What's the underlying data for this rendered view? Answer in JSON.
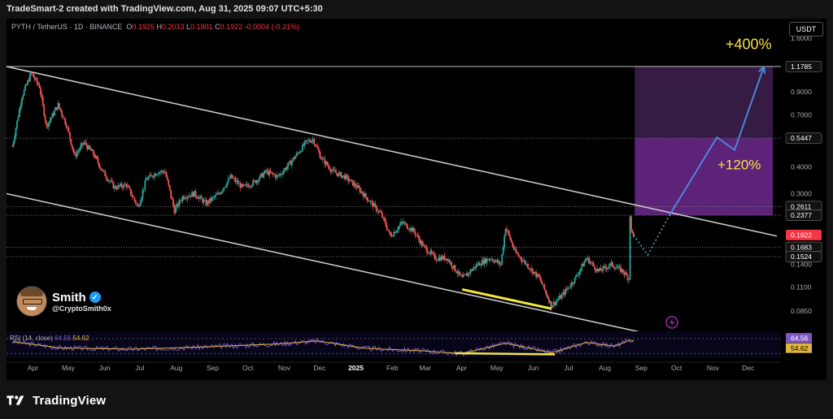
{
  "header": {
    "title": "TradeSmart-2 created with TradingView.com, Aug 31, 2025 09:07 UTC+5:30"
  },
  "symbol": {
    "name": "PYTH / TetherUS · 1D · BINANCE",
    "open_label": "O",
    "open": "0.1925",
    "high_label": "H",
    "high": "0.2013",
    "low_label": "L",
    "low": "0.1901",
    "close_label": "C",
    "close": "0.1922",
    "change": "-0.0004 (-0.21%)"
  },
  "currency": "USDT",
  "author": {
    "name": "Smith",
    "handle": "@CryptoSmith0x"
  },
  "footer": {
    "brand": "TradingView"
  },
  "rsi": {
    "label": "RSI (14, close)",
    "value_a": "64.56",
    "value_b": "54.62"
  },
  "colors": {
    "up": "#26a69a",
    "down": "#ef5350",
    "channel": "#c8c8c8",
    "projection": "#4a90e2",
    "zone_low": "#7b2fa0",
    "zone_high": "#3c1f4d",
    "highlight": "#f5e642",
    "rsi_line": "#7e57c2",
    "rsi_ma": "#e0b43a"
  },
  "annotations": {
    "target_high": "+400%",
    "target_mid": "+120%"
  },
  "chart_data": {
    "type": "candlestick",
    "title": "PYTH / TetherUS · 1D · BINANCE",
    "y_scale": "log",
    "ylim": [
      0.07,
      1.7
    ],
    "xlabel": "",
    "ylabel": "",
    "x_ticks": [
      "Apr",
      "May",
      "Jun",
      "Jul",
      "Aug",
      "Sep",
      "Oct",
      "Nov",
      "Dec",
      "2025",
      "Feb",
      "Mar",
      "Apr",
      "May",
      "Jun",
      "Jul",
      "Aug",
      "Sep",
      "Oct",
      "Nov",
      "Dec"
    ],
    "y_ticks": [
      "1.6000",
      "0.9000",
      "0.7000",
      "0.4000",
      "0.3000",
      "0.1400",
      "0.1100",
      "0.0850"
    ],
    "price_labels": [
      {
        "value": "1.1785",
        "kind": "level"
      },
      {
        "value": "0.5447",
        "kind": "level"
      },
      {
        "value": "0.2611",
        "kind": "level"
      },
      {
        "value": "0.2377",
        "kind": "level"
      },
      {
        "value": "0.1922",
        "kind": "last"
      },
      {
        "value": "0.1683",
        "kind": "level"
      },
      {
        "value": "0.1524",
        "kind": "level"
      }
    ],
    "price_path": [
      [
        "2024-03-20",
        0.5
      ],
      [
        "2024-03-28",
        0.85
      ],
      [
        "2024-04-05",
        1.1
      ],
      [
        "2024-04-12",
        0.95
      ],
      [
        "2024-04-18",
        0.62
      ],
      [
        "2024-04-28",
        0.78
      ],
      [
        "2024-05-05",
        0.63
      ],
      [
        "2024-05-12",
        0.45
      ],
      [
        "2024-05-20",
        0.52
      ],
      [
        "2024-05-28",
        0.46
      ],
      [
        "2024-06-05",
        0.38
      ],
      [
        "2024-06-15",
        0.32
      ],
      [
        "2024-06-25",
        0.33
      ],
      [
        "2024-07-05",
        0.26
      ],
      [
        "2024-07-12",
        0.35
      ],
      [
        "2024-07-22",
        0.38
      ],
      [
        "2024-07-28",
        0.38
      ],
      [
        "2024-08-05",
        0.25
      ],
      [
        "2024-08-12",
        0.29
      ],
      [
        "2024-08-22",
        0.3
      ],
      [
        "2024-09-01",
        0.27
      ],
      [
        "2024-09-12",
        0.3
      ],
      [
        "2024-09-22",
        0.36
      ],
      [
        "2024-10-02",
        0.32
      ],
      [
        "2024-10-12",
        0.34
      ],
      [
        "2024-10-22",
        0.38
      ],
      [
        "2024-11-01",
        0.36
      ],
      [
        "2024-11-12",
        0.42
      ],
      [
        "2024-11-25",
        0.52
      ],
      [
        "2024-12-01",
        0.54
      ],
      [
        "2024-12-08",
        0.44
      ],
      [
        "2024-12-18",
        0.38
      ],
      [
        "2024-12-28",
        0.36
      ],
      [
        "2025-01-08",
        0.32
      ],
      [
        "2025-01-20",
        0.27
      ],
      [
        "2025-01-28",
        0.24
      ],
      [
        "2025-02-05",
        0.19
      ],
      [
        "2025-02-15",
        0.22
      ],
      [
        "2025-02-25",
        0.2
      ],
      [
        "2025-03-05",
        0.17
      ],
      [
        "2025-03-15",
        0.15
      ],
      [
        "2025-03-25",
        0.15
      ],
      [
        "2025-04-07",
        0.12
      ],
      [
        "2025-04-20",
        0.14
      ],
      [
        "2025-05-01",
        0.15
      ],
      [
        "2025-05-10",
        0.14
      ],
      [
        "2025-05-14",
        0.21
      ],
      [
        "2025-05-22",
        0.16
      ],
      [
        "2025-06-01",
        0.14
      ],
      [
        "2025-06-12",
        0.12
      ],
      [
        "2025-06-22",
        0.09
      ],
      [
        "2025-07-01",
        0.1
      ],
      [
        "2025-07-12",
        0.12
      ],
      [
        "2025-07-22",
        0.15
      ],
      [
        "2025-08-01",
        0.13
      ],
      [
        "2025-08-12",
        0.14
      ],
      [
        "2025-08-22",
        0.13
      ],
      [
        "2025-08-27",
        0.12
      ],
      [
        "2025-08-28",
        0.24
      ],
      [
        "2025-08-29",
        0.2
      ],
      [
        "2025-08-31",
        0.1922
      ]
    ],
    "channel_upper": [
      [
        "2024-03-15",
        1.1785
      ],
      [
        "2025-12-31",
        0.19
      ]
    ],
    "channel_lower": [
      [
        "2024-03-15",
        0.3
      ],
      [
        "2025-09-20",
        0.065
      ]
    ],
    "projection": [
      [
        "2025-08-31",
        0.1922
      ],
      [
        "2025-09-12",
        0.155
      ],
      [
        "2025-10-01",
        0.24
      ],
      [
        "2025-11-10",
        0.55
      ],
      [
        "2025-11-25",
        0.48
      ],
      [
        "2025-12-20",
        1.1785
      ]
    ],
    "zones": [
      {
        "from": 0.5447,
        "to": 1.1785,
        "label": "+400%"
      },
      {
        "from": 0.2377,
        "to": 0.5447,
        "label": "+120%"
      }
    ],
    "rsi_series": [
      [
        "2024-03-20",
        62
      ],
      [
        "2024-05-01",
        45
      ],
      [
        "2024-07-01",
        42
      ],
      [
        "2024-09-01",
        48
      ],
      [
        "2024-11-01",
        56
      ],
      [
        "2024-12-05",
        64
      ],
      [
        "2025-01-15",
        44
      ],
      [
        "2025-03-01",
        38
      ],
      [
        "2025-04-07",
        30
      ],
      [
        "2025-05-14",
        58
      ],
      [
        "2025-06-22",
        32
      ],
      [
        "2025-07-22",
        60
      ],
      [
        "2025-08-15",
        50
      ],
      [
        "2025-08-28",
        66
      ],
      [
        "2025-08-31",
        64.56
      ]
    ]
  }
}
